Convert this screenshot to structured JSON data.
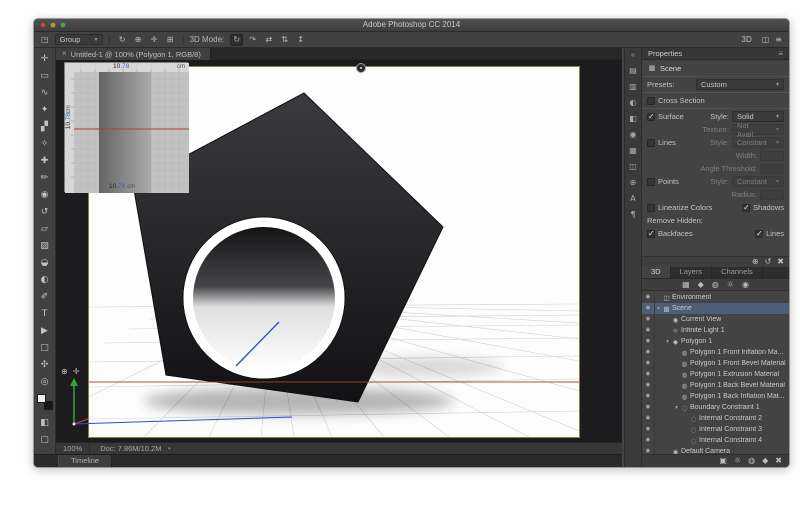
{
  "window": {
    "title": "Adobe Photoshop CC 2014",
    "workspace_label": "3D"
  },
  "options_bar": {
    "group_label": "Group",
    "mode_label": "3D Mode:",
    "transform_icons": [
      {
        "name": "rotate-3d-object-icon",
        "glyph": "↻"
      },
      {
        "name": "roll-3d-object-icon",
        "glyph": "⊕"
      },
      {
        "name": "drag-3d-object-icon",
        "glyph": "✛"
      },
      {
        "name": "scale-3d-object-icon",
        "glyph": "⊞"
      }
    ],
    "mode_icons": [
      {
        "name": "orbit-3d-camera-icon",
        "glyph": "↻",
        "cls": "active"
      },
      {
        "name": "roll-3d-camera-icon",
        "glyph": "↷"
      },
      {
        "name": "pan-3d-camera-icon",
        "glyph": "⇄"
      },
      {
        "name": "slide-3d-camera-icon",
        "glyph": "⇅"
      },
      {
        "name": "zoom-3d-camera-icon",
        "glyph": "↕"
      }
    ],
    "right_icons": [
      {
        "name": "workspace-switcher-icon",
        "glyph": "◫"
      },
      {
        "name": "panel-menu-icon",
        "glyph": "≡"
      }
    ]
  },
  "document_tab": {
    "close_glyph": "×",
    "label": "Untitled-1 @ 100% (Polygon 1, RGB/8)"
  },
  "tools": [
    {
      "name": "move-tool",
      "glyph": "✛"
    },
    {
      "name": "marquee-tool",
      "glyph": "▭"
    },
    {
      "name": "lasso-tool",
      "glyph": "∿"
    },
    {
      "name": "quick-selection-tool",
      "glyph": "✦"
    },
    {
      "name": "crop-tool",
      "glyph": "▞"
    },
    {
      "name": "eyedropper-tool",
      "glyph": "✧"
    },
    {
      "name": "healing-brush-tool",
      "glyph": "✚"
    },
    {
      "name": "brush-tool",
      "glyph": "✏"
    },
    {
      "name": "clone-stamp-tool",
      "glyph": "◉"
    },
    {
      "name": "history-brush-tool",
      "glyph": "↺"
    },
    {
      "name": "eraser-tool",
      "glyph": "▱"
    },
    {
      "name": "gradient-tool",
      "glyph": "▨"
    },
    {
      "name": "blur-tool",
      "glyph": "◒"
    },
    {
      "name": "dodge-tool",
      "glyph": "◐"
    },
    {
      "name": "pen-tool",
      "glyph": "✐"
    },
    {
      "name": "type-tool",
      "glyph": "T"
    },
    {
      "name": "path-selection-tool",
      "glyph": "▶"
    },
    {
      "name": "rectangle-tool",
      "glyph": "□"
    },
    {
      "name": "hand-tool",
      "glyph": "✣"
    },
    {
      "name": "zoom-tool",
      "glyph": "◎"
    }
  ],
  "toolbar_extras": [
    {
      "name": "quick-mask-icon",
      "glyph": "◧"
    },
    {
      "name": "screen-mode-icon",
      "glyph": "▢"
    }
  ],
  "canvas": {
    "secondary_view": {
      "value_prefix": "10.",
      "value_highlight": "78",
      "unit": "cm"
    }
  },
  "properties": {
    "title": "Properties",
    "menu_glyph": "≡",
    "target": "Scene",
    "presets_label": "Presets:",
    "presets_value": "Custom",
    "cross_section": "Cross Section",
    "surface": "Surface",
    "style_label": "Style:",
    "surface_style": "Solid",
    "texture_label": "Texture:",
    "texture_value": "Not Avail...",
    "lines": "Lines",
    "lines_style": "Constant",
    "width_label": "Width:",
    "angle_label": "Angle Threshold:",
    "points": "Points",
    "points_style": "Constant",
    "radius_label": "Radius:",
    "linearize": "Linearize Colors",
    "shadows": "Shadows",
    "remove_hidden": "Remove Hidden:",
    "backfaces": "Backfaces",
    "lines2": "Lines"
  },
  "props_bottom_icons": [
    {
      "name": "coordinates-icon",
      "glyph": "⊕"
    },
    {
      "name": "reset-properties-icon",
      "glyph": "↺"
    },
    {
      "name": "delete-icon",
      "glyph": "✖"
    }
  ],
  "panel_tabs": [
    {
      "name": "tab-3d",
      "label": "3D",
      "cls": "active"
    },
    {
      "name": "tab-layers",
      "label": "Layers"
    },
    {
      "name": "tab-channels",
      "label": "Channels"
    }
  ],
  "filter_icons": [
    {
      "name": "filter-all-icon",
      "glyph": "▦"
    },
    {
      "name": "filter-meshes-icon",
      "glyph": "◆"
    },
    {
      "name": "filter-materials-icon",
      "glyph": "◍"
    },
    {
      "name": "filter-lights-icon",
      "glyph": "☼"
    },
    {
      "name": "filter-cameras-icon",
      "glyph": "◉"
    }
  ],
  "scene_tree": {
    "items": [
      {
        "name": "tree-row-environment",
        "eye": "◉",
        "arrow": "",
        "glyph": "◫",
        "label": "Environment",
        "indent": 0
      },
      {
        "name": "tree-row-scene",
        "eye": "◉",
        "arrow": "▾",
        "glyph": "▩",
        "label": "Scene",
        "indent": 0,
        "selected": true
      },
      {
        "name": "tree-row-current-view",
        "eye": "◉",
        "arrow": "",
        "glyph": "◉",
        "label": "Current View",
        "indent": 1
      },
      {
        "name": "tree-row-infinite-light",
        "eye": "◉",
        "arrow": "",
        "glyph": "☼",
        "label": "Infinite Light 1",
        "indent": 1
      },
      {
        "name": "tree-row-polygon-1",
        "eye": "◉",
        "arrow": "▾",
        "glyph": "◆",
        "label": "Polygon 1",
        "indent": 1
      },
      {
        "name": "tree-row-front-inflation",
        "eye": "◉",
        "arrow": "",
        "glyph": "◍",
        "label": "Polygon 1 Front Inflation Ma...",
        "indent": 2
      },
      {
        "name": "tree-row-front-bevel",
        "eye": "◉",
        "arrow": "",
        "glyph": "◍",
        "label": "Polygon 1 Front Bevel Material",
        "indent": 2
      },
      {
        "name": "tree-row-extrusion",
        "eye": "◉",
        "arrow": "",
        "glyph": "◍",
        "label": "Polygon 1 Extrusion Material",
        "indent": 2
      },
      {
        "name": "tree-row-back-bevel",
        "eye": "◉",
        "arrow": "",
        "glyph": "◍",
        "label": "Polygon 1 Back Bevel Material",
        "indent": 2
      },
      {
        "name": "tree-row-back-inflation",
        "eye": "◉",
        "arrow": "",
        "glyph": "◍",
        "label": "Polygon 1 Back Inflation Mat...",
        "indent": 2
      },
      {
        "name": "tree-row-boundary-constraint",
        "eye": "◉",
        "arrow": "▾",
        "glyph": "◌",
        "label": "Boundary Constraint 1",
        "indent": 2
      },
      {
        "name": "tree-row-internal-constraint-2",
        "eye": "◉",
        "arrow": "",
        "glyph": "◌",
        "label": "Internal Constraint 2",
        "indent": 3
      },
      {
        "name": "tree-row-internal-constraint-3",
        "eye": "◉",
        "arrow": "",
        "glyph": "◌",
        "label": "Internal Constraint 3",
        "indent": 3
      },
      {
        "name": "tree-row-internal-constraint-4",
        "eye": "◉",
        "arrow": "",
        "glyph": "◌",
        "label": "Internal Constraint 4",
        "indent": 3
      },
      {
        "name": "tree-row-default-camera",
        "eye": "◉",
        "arrow": "",
        "glyph": "◉",
        "label": "Default Camera",
        "indent": 1
      }
    ]
  },
  "panel_bottom_icons": [
    {
      "name": "render-icon",
      "glyph": "▣"
    },
    {
      "name": "new-light-icon",
      "glyph": "☼"
    },
    {
      "name": "new-material-icon",
      "glyph": "◍"
    },
    {
      "name": "new-mesh-icon",
      "glyph": "◆"
    },
    {
      "name": "delete-item-icon",
      "glyph": "✖"
    }
  ],
  "dock_icons": [
    {
      "name": "dock-color-icon",
      "glyph": "▤"
    },
    {
      "name": "dock-swatches-icon",
      "glyph": "▥"
    },
    {
      "name": "dock-adjustments-icon",
      "glyph": "◐"
    },
    {
      "name": "dock-styles-icon",
      "glyph": "◧"
    },
    {
      "name": "dock-info-icon",
      "glyph": "◉"
    },
    {
      "name": "dock-histogram-icon",
      "glyph": "▦"
    },
    {
      "name": "dock-navigator-icon",
      "glyph": "◫"
    },
    {
      "name": "dock-clone-source-icon",
      "glyph": "⊕"
    },
    {
      "name": "dock-character-icon",
      "glyph": "A"
    },
    {
      "name": "dock-paragraph-icon",
      "glyph": "¶"
    }
  ],
  "status_bar": {
    "zoom": "100%",
    "doc_info": "Doc: 7.86M/10.2M",
    "caret": "‣"
  },
  "timeline": {
    "label": "Timeline"
  },
  "colors": {
    "selection_blue": "#4d5e77",
    "red_guide_line": "#b03a30",
    "axis_green": "#3a9e3a",
    "axis_blue": "#2d49d8",
    "scene_border_olive": "#82824a",
    "panel_bg": "#434343"
  }
}
